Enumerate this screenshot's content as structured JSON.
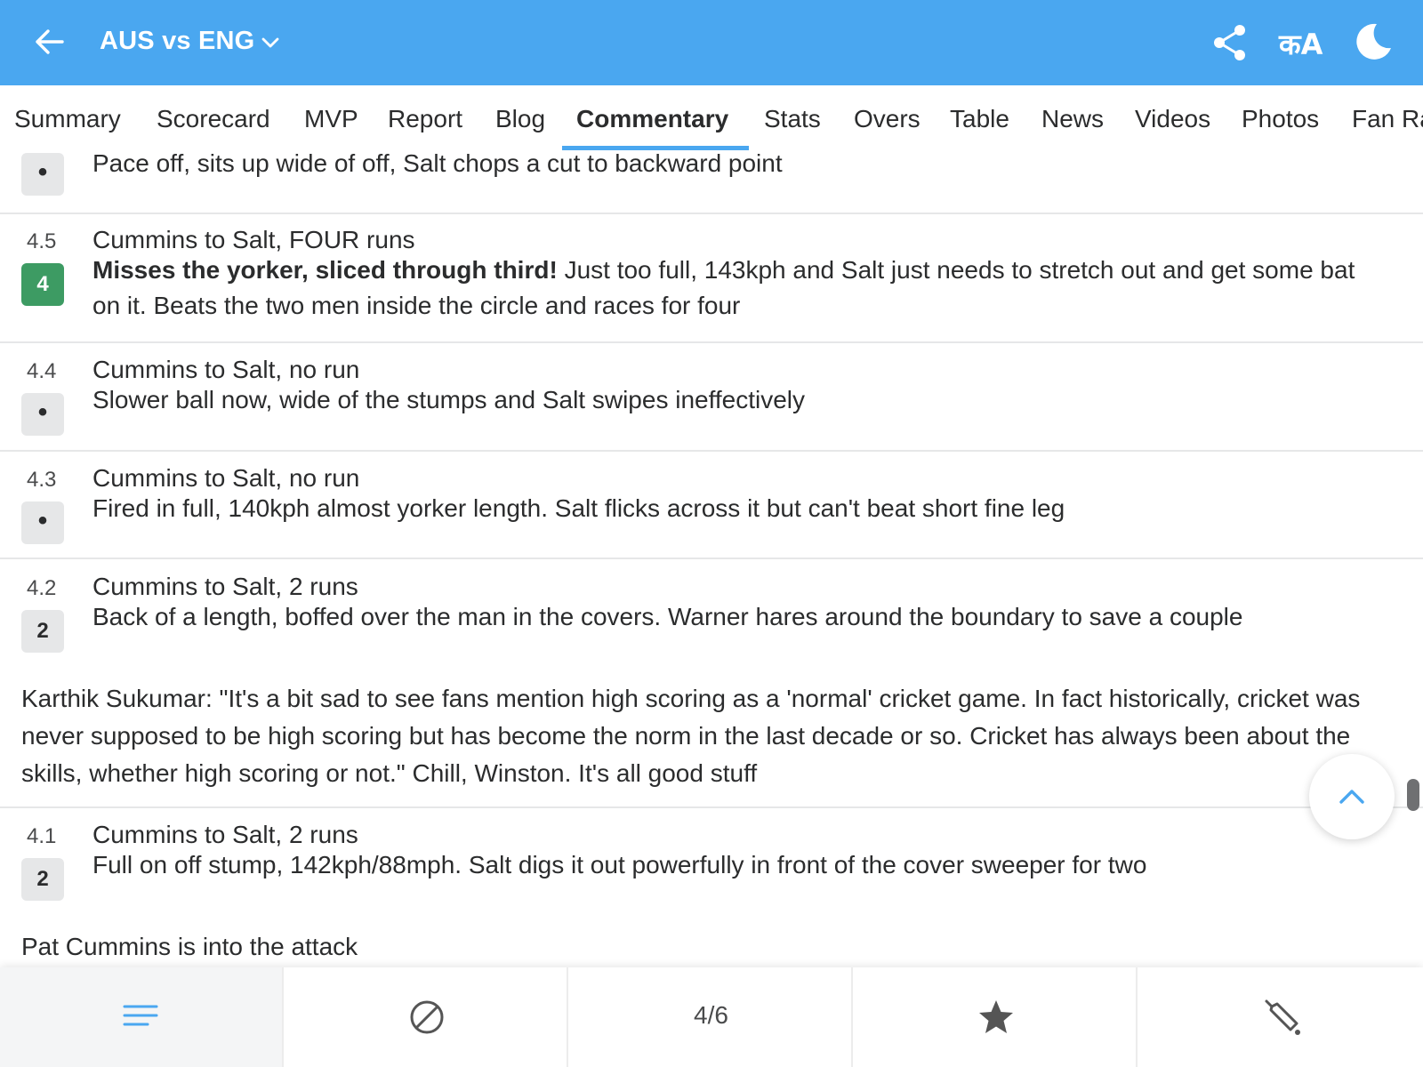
{
  "header": {
    "title": "AUS vs ENG",
    "lang_label": "कA"
  },
  "tabs": [
    {
      "label": "Summary"
    },
    {
      "label": "Scorecard"
    },
    {
      "label": "MVP"
    },
    {
      "label": "Report"
    },
    {
      "label": "Blog"
    },
    {
      "label": "Commentary",
      "active": true
    },
    {
      "label": "Stats"
    },
    {
      "label": "Overs"
    },
    {
      "label": "Table"
    },
    {
      "label": "News"
    },
    {
      "label": "Videos"
    },
    {
      "label": "Photos"
    },
    {
      "label": "Fan Ra"
    }
  ],
  "commentary": {
    "partial": {
      "ball": "•",
      "description": "Pace off, sits up wide of off, Salt chops a cut to backward point"
    },
    "b45": {
      "over": "4.5",
      "ball": "4",
      "headline": "Cummins to Salt, FOUR runs",
      "desc_bold": "Misses the yorker, sliced through third!",
      "desc_rest": " Just too full, 143kph and Salt just needs to stretch out and get some bat on it. Beats the two men inside the circle and races for four"
    },
    "b44": {
      "over": "4.4",
      "ball": "•",
      "headline": "Cummins to Salt, no run",
      "description": "Slower ball now, wide of the stumps and Salt swipes ineffectively"
    },
    "b43": {
      "over": "4.3",
      "ball": "•",
      "headline": "Cummins to Salt, no run",
      "description": "Fired in full, 140kph almost yorker length. Salt flicks across it but can't beat short fine leg"
    },
    "b42": {
      "over": "4.2",
      "ball": "2",
      "headline": "Cummins to Salt, 2 runs",
      "description": "Back of a length, boffed over the man in the covers. Warner hares around the boundary to save a couple"
    },
    "note1": "Karthik Sukumar: \"It's a bit sad to see fans mention high scoring as a 'normal' cricket game. In fact historically, cricket was never supposed to be high scoring but has become the norm in the last decade or so. Cricket has always been about the skills, whether high scoring or not.\" Chill, Winston. It's all good stuff",
    "b41": {
      "over": "4.1",
      "ball": "2",
      "headline": "Cummins to Salt, 2 runs",
      "description": "Full on off stump, 142kph/88mph. Salt digs it out powerfully in front of the cover sweeper for two"
    },
    "note2": "Pat Cummins is into the attack"
  },
  "bottom_bar": {
    "items": [
      {
        "icon": "menu-lines-icon"
      },
      {
        "icon": "cricket-ball-icon"
      },
      {
        "count": "4/6"
      },
      {
        "icon": "star-icon"
      },
      {
        "icon": "cricket-bat-icon"
      }
    ]
  },
  "colors": {
    "header_bg": "#4aa7f0",
    "four_badge": "#3d9b63",
    "ball_badge": "#e6e7e8",
    "accent": "#4aa7f0"
  }
}
